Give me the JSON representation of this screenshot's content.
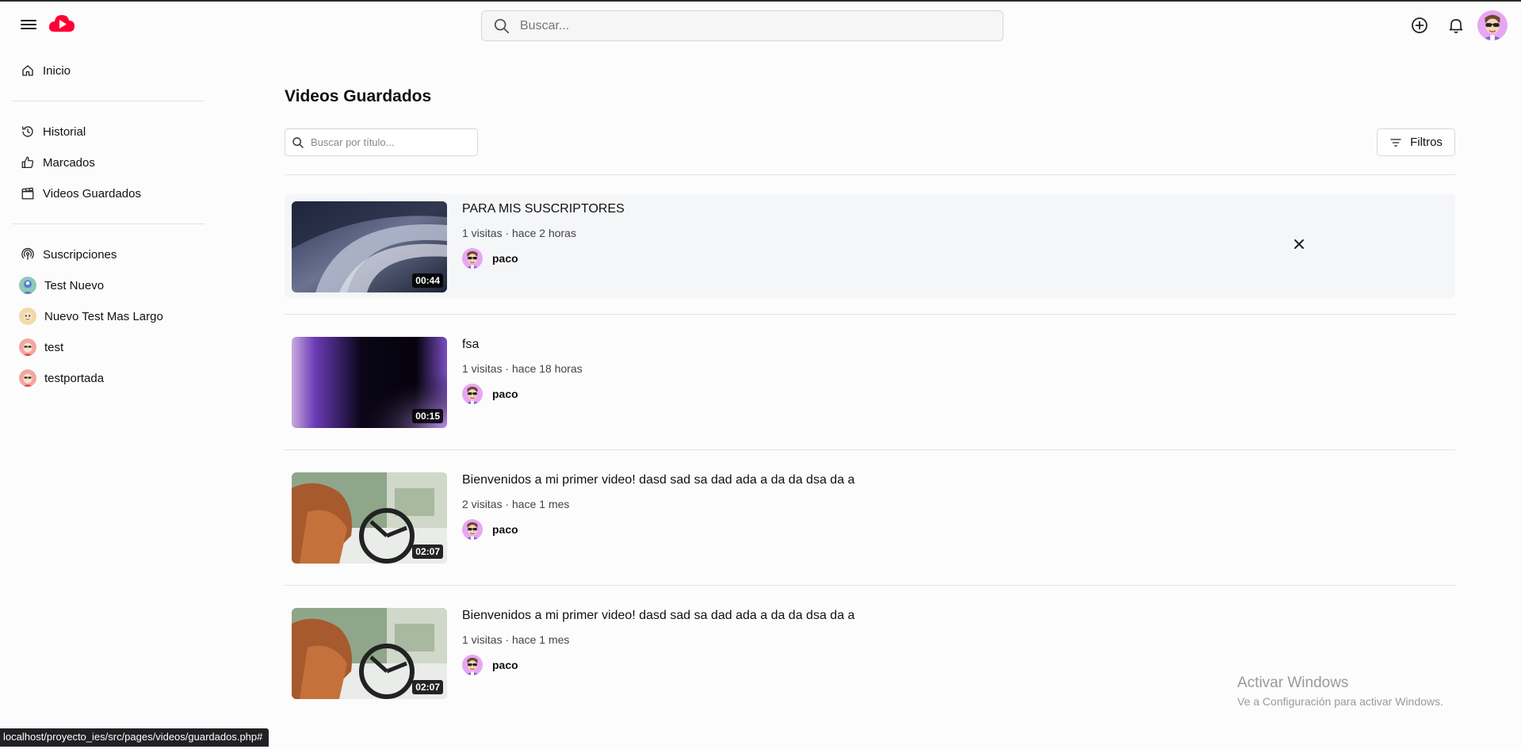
{
  "header": {
    "search_placeholder": "Buscar...",
    "brand_color": "#ff0033"
  },
  "sidebar": {
    "main_items": [
      {
        "label": "Inicio",
        "icon": "home-icon"
      }
    ],
    "library_items": [
      {
        "label": "Historial",
        "icon": "history-icon"
      },
      {
        "label": "Marcados",
        "icon": "thumbs-up-icon"
      },
      {
        "label": "Videos Guardados",
        "icon": "clapperboard-icon"
      }
    ],
    "subscriptions_label": "Suscripciones",
    "subscriptions": [
      {
        "label": "Test Nuevo",
        "avatar_color": "#8fc9b8"
      },
      {
        "label": "Nuevo Test Mas Largo",
        "avatar_color": "#f2d9a8"
      },
      {
        "label": "test",
        "avatar_color": "#f2a7a0"
      },
      {
        "label": "testportada",
        "avatar_color": "#f2a7a0"
      }
    ]
  },
  "main": {
    "title": "Videos Guardados",
    "search_placeholder": "Buscar por título...",
    "filters_label": "Filtros",
    "videos": [
      {
        "title": "PARA MIS SUSCRIPTORES",
        "meta": "1 visitas · hace 2 horas",
        "channel": "paco",
        "duration": "00:44"
      },
      {
        "title": "fsa",
        "meta": "1 visitas · hace 18 horas",
        "channel": "paco",
        "duration": "00:15"
      },
      {
        "title": "Bienvenidos a mi primer video! dasd sad sa dad ada a da da dsa da a",
        "meta": "2 visitas · hace 1 mes",
        "channel": "paco",
        "duration": "02:07"
      },
      {
        "title": "Bienvenidos a mi primer video! dasd sad sa dad ada a da da dsa da a",
        "meta": "1 visitas · hace 1 mes",
        "channel": "paco",
        "duration": "02:07"
      }
    ]
  },
  "watermark": {
    "line1": "Activar Windows",
    "line2": "Ve a Configuración para activar Windows."
  },
  "status_bar": {
    "url": "localhost/proyecto_ies/src/pages/videos/guardados.php#"
  }
}
